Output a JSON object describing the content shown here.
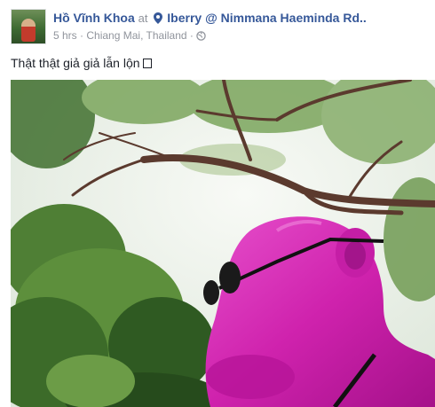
{
  "post": {
    "author": "Hồ Vĩnh Khoa",
    "at_text": "at",
    "place": "Iberry @ Nimmana Haeminda Rd..",
    "time": "5 hrs",
    "separator1": "·",
    "location": "Chiang Mai, Thailand",
    "separator2": "·",
    "caption": "Thật thật giả giả lẫn lộn"
  },
  "icons": {
    "location": "map-pin-icon",
    "privacy": "globe-icon",
    "unknown_glyph": "missing-glyph-box"
  },
  "colors": {
    "link": "#365899",
    "meta": "#90949c",
    "text": "#1d2129",
    "statue": "#d62fb6"
  }
}
